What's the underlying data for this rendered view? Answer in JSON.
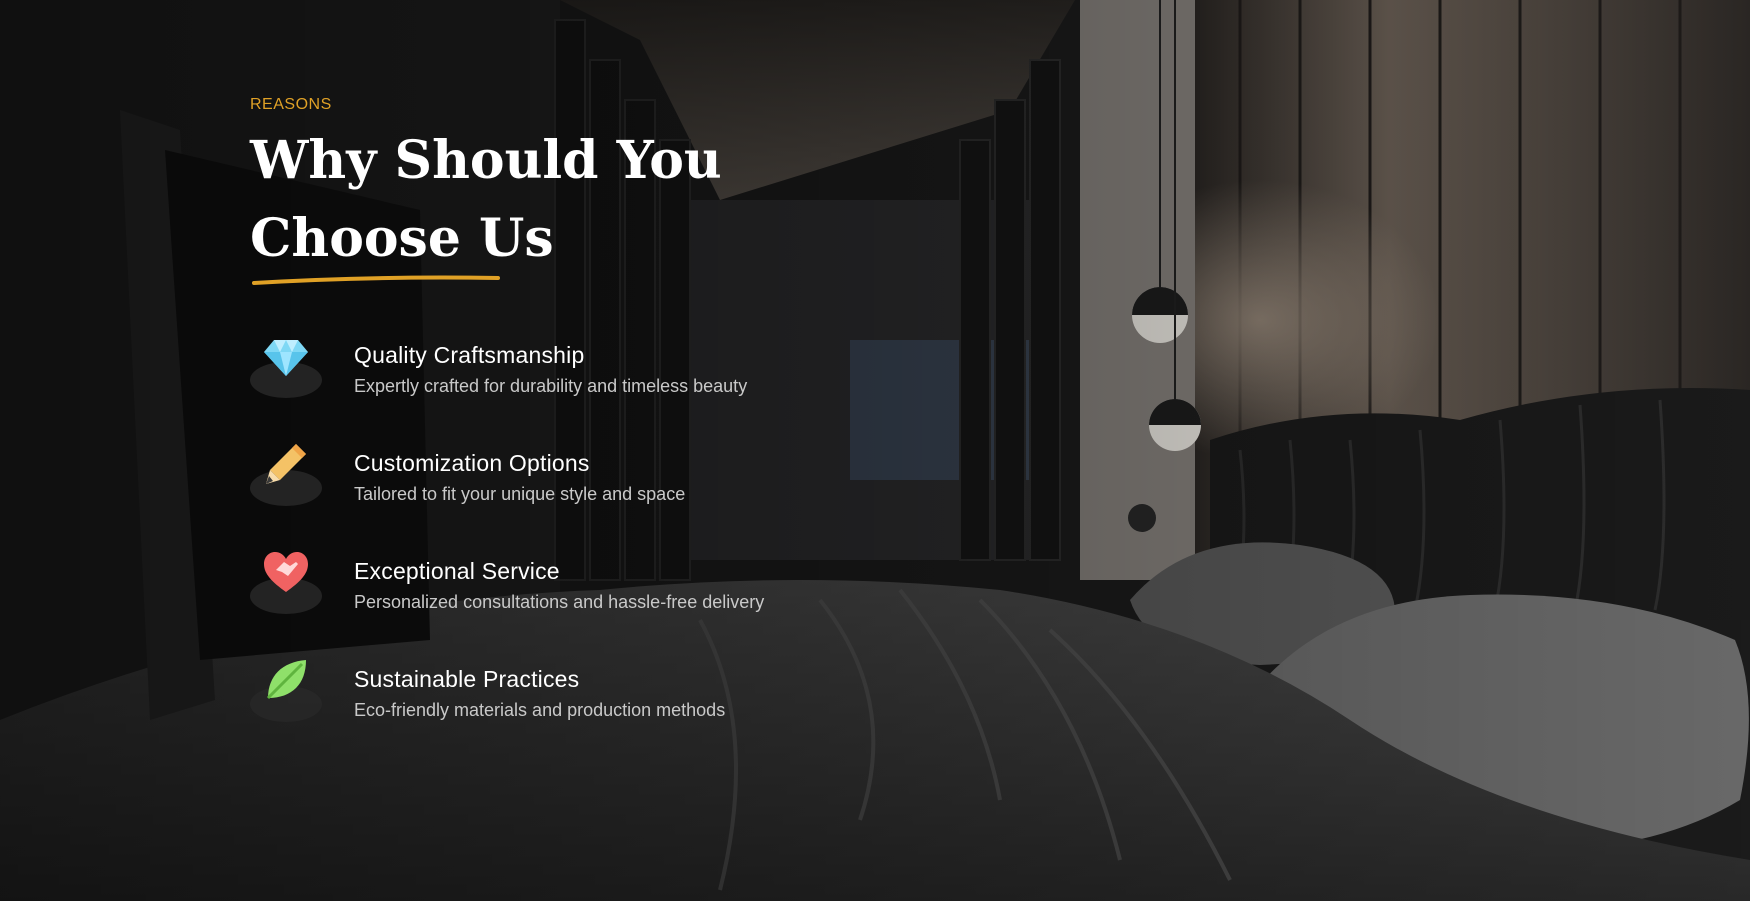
{
  "section": {
    "eyebrow": "REASONS",
    "heading_line1": "Why Should You",
    "heading_line2": "Choose Us",
    "accent_color": "#e0a126"
  },
  "features": [
    {
      "icon": "diamond-icon",
      "title": "Quality Craftsmanship",
      "description": "Expertly crafted for durability and timeless beauty",
      "icon_color": "#7fd8f5"
    },
    {
      "icon": "pencil-icon",
      "title": "Customization Options",
      "description": "Tailored to fit your unique style and space",
      "icon_color": "#f4c266"
    },
    {
      "icon": "heart-handshake-icon",
      "title": "Exceptional Service",
      "description": "Personalized consultations and hassle-free delivery",
      "icon_color": "#f06262"
    },
    {
      "icon": "leaf-icon",
      "title": "Sustainable Practices",
      "description": "Eco-friendly materials and production methods",
      "icon_color": "#8fe06a"
    }
  ]
}
